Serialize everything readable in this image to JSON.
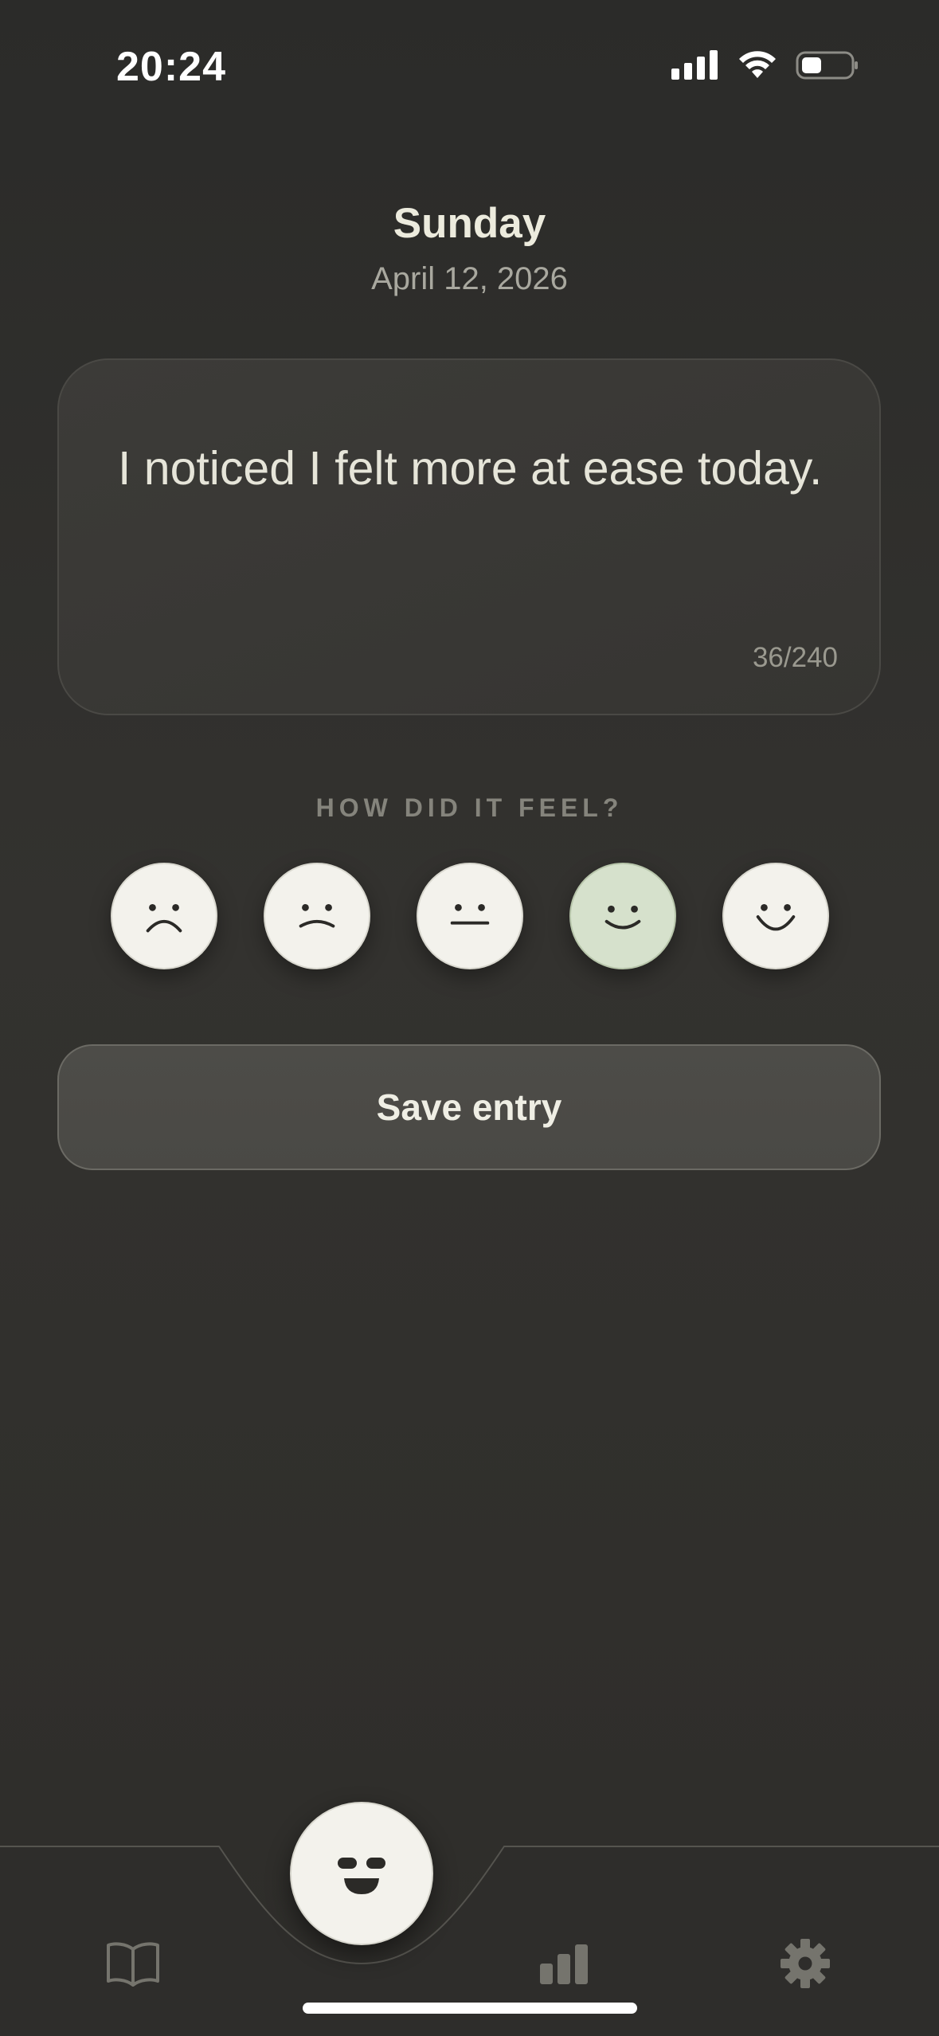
{
  "status_bar": {
    "time": "20:24",
    "icons": [
      "cellular-signal-icon",
      "wifi-icon",
      "battery-icon"
    ]
  },
  "header": {
    "day": "Sunday",
    "date": "April 12, 2026"
  },
  "entry": {
    "text": "I noticed I felt more at ease today.",
    "counter": "36/240"
  },
  "mood": {
    "prompt": "HOW DID IT FEEL?",
    "options": [
      "very-sad",
      "sad",
      "neutral",
      "happy",
      "very-happy"
    ],
    "selected_index": 3
  },
  "actions": {
    "save_label": "Save entry"
  },
  "tab_bar": {
    "items": [
      "journal-book-icon",
      "mood-face-icon",
      "stats-bar-chart-icon",
      "settings-gear-icon"
    ],
    "active": "mood-face-icon"
  },
  "colors": {
    "background": "#2f2e2b",
    "card": "#3a3936",
    "selected_mood": "#d6e1cc",
    "face_fill": "#f3f2ec",
    "text_primary": "#ecebdd",
    "text_muted": "#a9a89f"
  }
}
